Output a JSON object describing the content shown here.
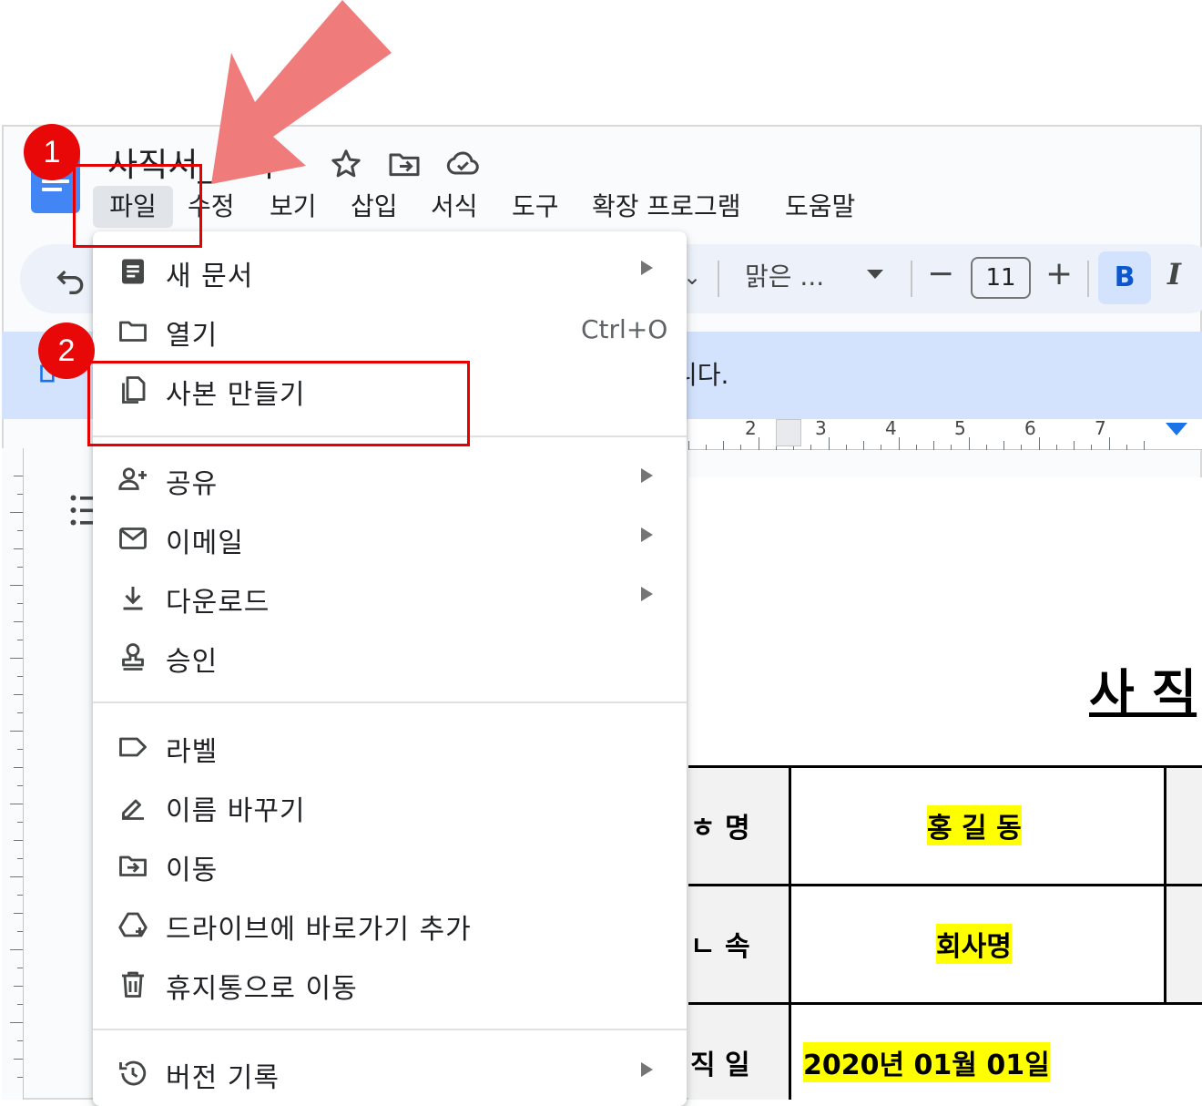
{
  "colors": {
    "accent_red": "#e60000",
    "arrow": "#f07b7b",
    "docs_blue": "#4285f4",
    "highlight": "#ffff00",
    "toolbar_bg": "#edf2fa",
    "banner_bg": "#d3e3fd"
  },
  "document": {
    "title": "사직서_양식",
    "title_icons": [
      "star-icon",
      "move-folder-icon",
      "cloud-saved-icon"
    ]
  },
  "menubar": {
    "items": [
      "파일",
      "수정",
      "보기",
      "삽입",
      "서식",
      "도구",
      "확장 프로그램",
      "도움말"
    ],
    "active": "파일"
  },
  "toolbar": {
    "font_name": "맑은 ...",
    "font_size": "11",
    "minus": "−",
    "plus": "+",
    "bold": "B",
    "italic": "I"
  },
  "banner": {
    "text": "니다."
  },
  "ruler": {
    "numbers": [
      "2",
      "3",
      "4",
      "5",
      "6",
      "7"
    ]
  },
  "file_menu": {
    "groups": [
      [
        {
          "icon": "new-document-icon",
          "label": "새 문서",
          "submenu": true
        },
        {
          "icon": "open-folder-icon",
          "label": "열기",
          "shortcut": "Ctrl+O"
        },
        {
          "icon": "copy-icon",
          "label": "사본 만들기"
        }
      ],
      [
        {
          "icon": "share-person-add-icon",
          "label": "공유",
          "submenu": true
        },
        {
          "icon": "email-icon",
          "label": "이메일",
          "submenu": true
        },
        {
          "icon": "download-icon",
          "label": "다운로드",
          "submenu": true
        },
        {
          "icon": "approval-stamp-icon",
          "label": "승인"
        }
      ],
      [
        {
          "icon": "label-icon",
          "label": "라벨"
        },
        {
          "icon": "rename-icon",
          "label": "이름 바꾸기"
        },
        {
          "icon": "move-icon",
          "label": "이동"
        },
        {
          "icon": "drive-shortcut-icon",
          "label": "드라이브에 바로가기 추가"
        },
        {
          "icon": "trash-icon",
          "label": "휴지통으로 이동"
        }
      ],
      [
        {
          "icon": "version-history-icon",
          "label": "버전 기록",
          "submenu": true
        }
      ]
    ]
  },
  "doc_body": {
    "heading": "사 직",
    "rows": [
      {
        "label": "성 명",
        "label_visible": "ㅎ 명",
        "value": "홍 길 동"
      },
      {
        "label_visible": "ㄴ 속",
        "value": "회사명"
      },
      {
        "label_visible": "직 일",
        "value": "2020년 01월 01일"
      }
    ]
  },
  "annotations": {
    "step1": "1",
    "step2": "2"
  }
}
